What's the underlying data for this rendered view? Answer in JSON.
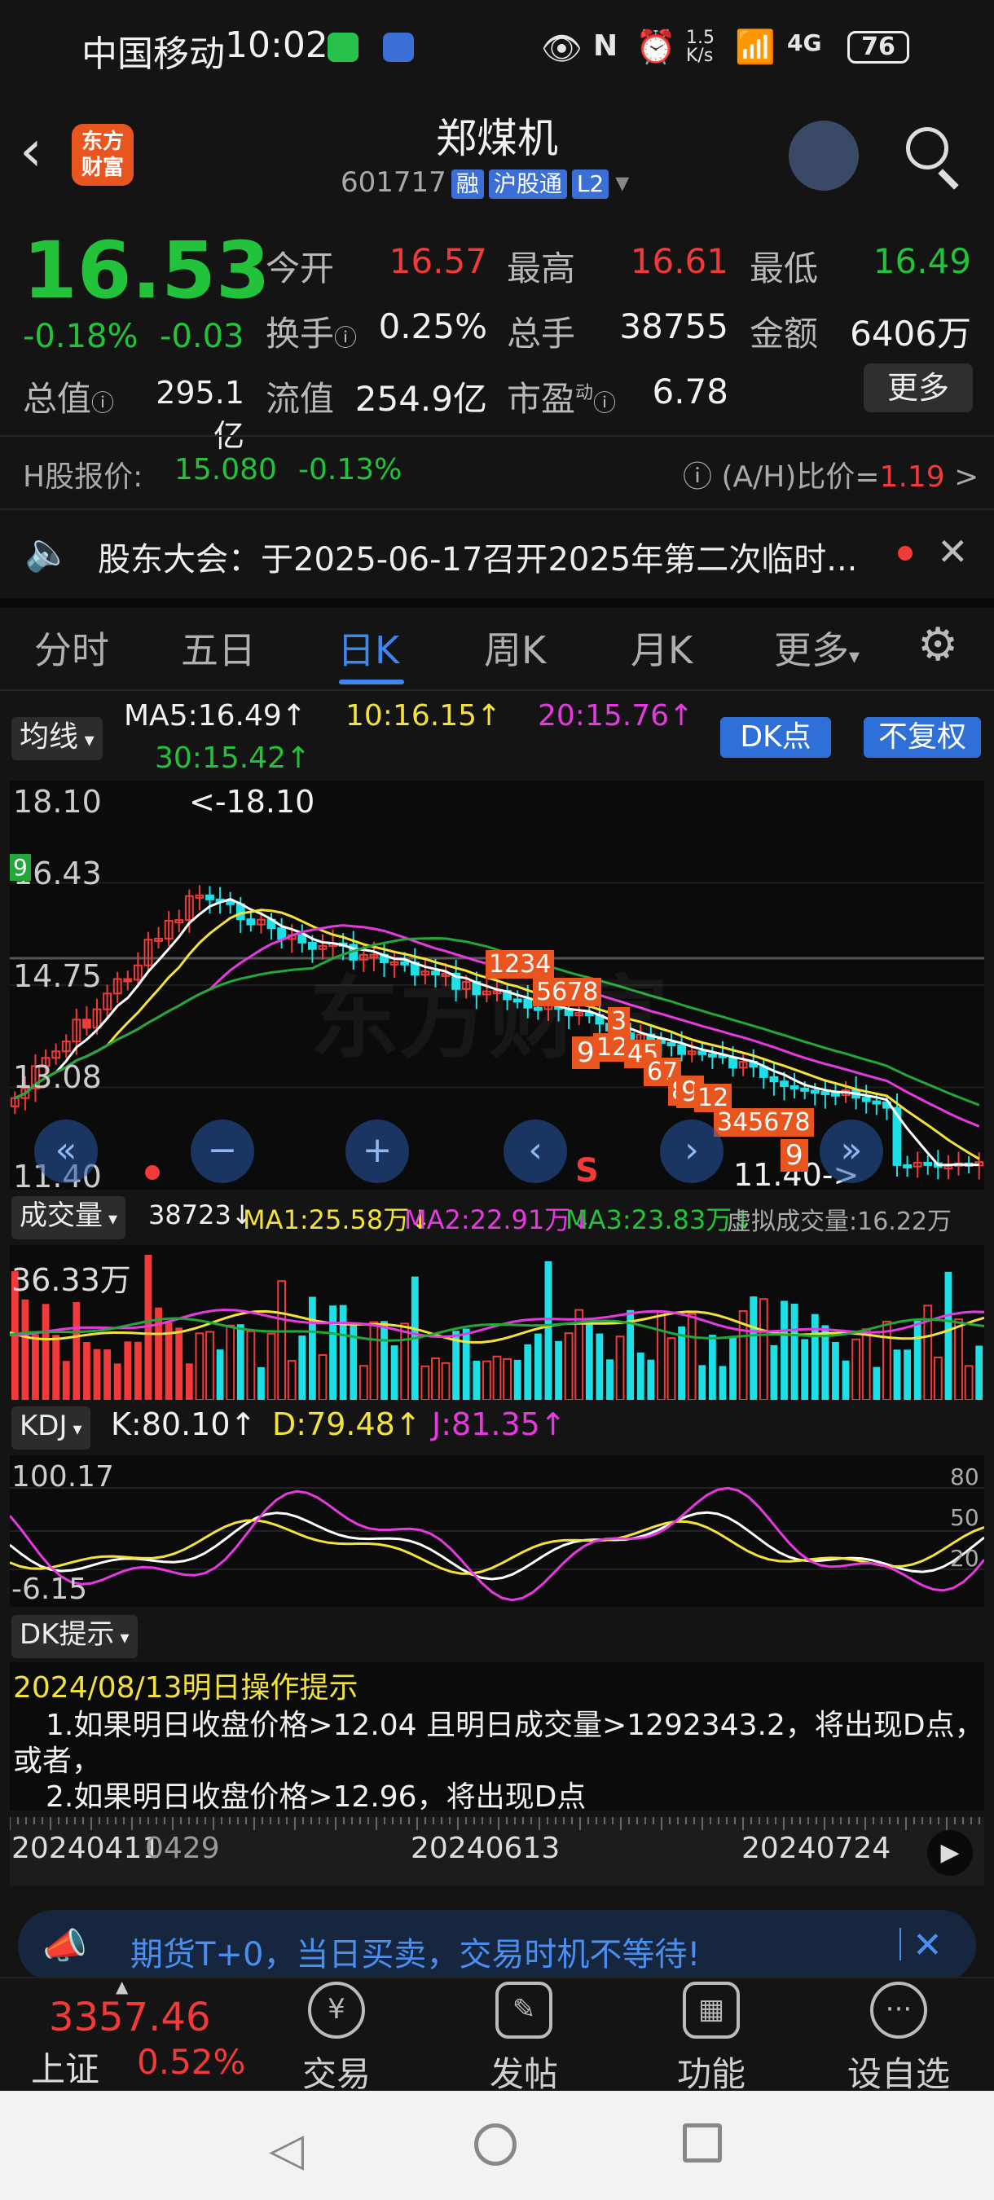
{
  "status_bar": {
    "carrier": "中国移动",
    "time": "10:02",
    "speed": "1.5 K/s",
    "signal": "4G",
    "battery": "76"
  },
  "header": {
    "title": "郑煤机",
    "code": "601717",
    "tags": [
      "融",
      "沪股通",
      "L2"
    ],
    "logo_text": "东方财富"
  },
  "quote": {
    "price": "16.53",
    "change_pct": "-0.18%",
    "change": "-0.03",
    "open_label": "今开",
    "open": "16.57",
    "high_label": "最高",
    "high": "16.61",
    "low_label": "最低",
    "low": "16.49",
    "turnover_label": "换手",
    "turnover": "0.25%",
    "volume_label": "总手",
    "volume": "38755",
    "amount_label": "金额",
    "amount": "6406万",
    "mktcap_label": "总值",
    "mktcap": "295.1亿",
    "float_label": "流值",
    "float": "254.9亿",
    "pe_label": "市盈",
    "pe_sup": "动",
    "pe": "6.78",
    "more_label": "更多"
  },
  "hshare": {
    "label": "H股报价:",
    "price": "15.080",
    "pct": "-0.13%",
    "ratio_label": "(A/H)比价=",
    "ratio": "1.19",
    "arrow": ">"
  },
  "notice": {
    "text": "股东大会：于2025-06-17召开2025年第二次临时..."
  },
  "tabs": [
    "分时",
    "五日",
    "日K",
    "周K",
    "月K",
    "更多"
  ],
  "active_tab": "日K",
  "ma_bar": {
    "selector": "均线",
    "ma5": "MA5:16.49↑",
    "ma10": "10:16.15↑",
    "ma20": "20:15.76↑",
    "ma30": "30:15.42↑",
    "dk_button": "DK点",
    "fq_button": "不复权"
  },
  "kline": {
    "y_labels": [
      "18.10",
      "16.43",
      "14.75",
      "13.08",
      "11.40"
    ],
    "high_note": "<-18.10",
    "low_note": "11.40->",
    "sell_mark": "S",
    "seq_labels": [
      "1234",
      "5678",
      "9",
      "12",
      "3",
      "45",
      "67",
      "8",
      "9",
      "12",
      "345678",
      "9",
      "9"
    ]
  },
  "volume_bar": {
    "selector": "成交量",
    "vol": "38723↓",
    "ma1": "MA1:25.58万↓",
    "ma2": "MA2:22.91万↓",
    "ma3": "MA3:23.83万↓",
    "virtual": "虚拟成交量:16.22万",
    "max_label": "36.33万"
  },
  "kdj_bar": {
    "selector": "KDJ",
    "k": "K:80.10↑",
    "d": "D:79.48↑",
    "j": "J:81.35↑",
    "max_label": "100.17",
    "min_label": "-6.15",
    "right_labels": [
      "80",
      "50",
      "20"
    ]
  },
  "dk_tips": {
    "selector": "DK提示",
    "title": "2024/08/13明日操作提示",
    "line1": "1.如果明日收盘价格>12.04 且明日成交量>1292343.2，将出现D点，",
    "line1b": "或者，",
    "line2": "2.如果明日收盘价格>12.96，将出现D点"
  },
  "timeline": {
    "dates": [
      "20240411",
      "0429",
      "20240613",
      "20240724"
    ]
  },
  "ad": {
    "text": "期货T+0，当日买卖，交易时机不等待!"
  },
  "bottom_nav": {
    "index_value": "3357.46",
    "index_name": "上证",
    "index_pct": "0.52%",
    "items": [
      "交易",
      "发帖",
      "功能",
      "设自选"
    ]
  },
  "colors": {
    "up": "#f23a3a",
    "down": "#22c33b",
    "accent": "#3d87ef",
    "ma_yellow": "#f3e23a",
    "ma_magenta": "#e63ae0",
    "ma_green": "#22a83a",
    "bar_cyan": "#1de0e6"
  }
}
